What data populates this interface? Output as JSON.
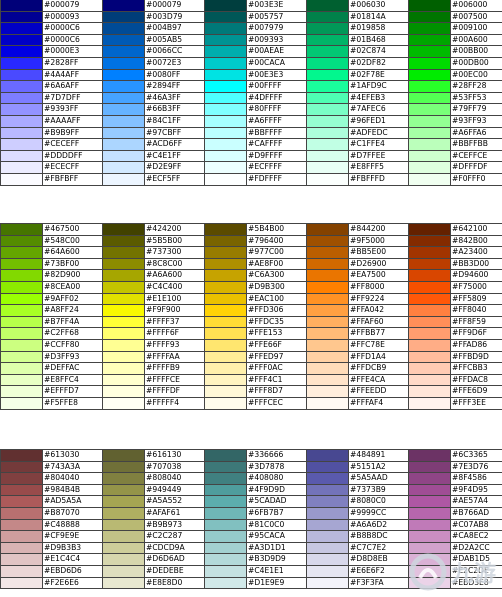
{
  "palette_blocks": [
    {
      "columns": [
        [
          "#000079",
          "#000093",
          "#0000C6",
          "#0000C6",
          "#0000E3",
          "#2828FF",
          "#4A4AFF",
          "#6A6AFF",
          "#7D7DFF",
          "#9393FF",
          "#AAAAFF",
          "#B9B9FF",
          "#CECEFF",
          "#DDDDFF",
          "#ECECFF",
          "#FBFBFF"
        ],
        [
          "#000079",
          "#003D79",
          "#004B97",
          "#005AB5",
          "#0066CC",
          "#0072E3",
          "#0080FF",
          "#2894FF",
          "#46A3FF",
          "#66B3FF",
          "#84C1FF",
          "#97CBFF",
          "#ACD6FF",
          "#C4E1FF",
          "#D2E9FF",
          "#ECF5FF"
        ],
        [
          "#003E3E",
          "#005757",
          "#007979",
          "#009393",
          "#00AEAE",
          "#00CACA",
          "#00E3E3",
          "#00FFFF",
          "#4DFFFF",
          "#80FFFF",
          "#A6FFFF",
          "#BBFFFF",
          "#CAFFFF",
          "#D9FFFF",
          "#ECFFFF",
          "#FDFFFF"
        ],
        [
          "#006030",
          "#01814A",
          "#019858",
          "#01B468",
          "#02C874",
          "#02DF82",
          "#02F78E",
          "#1AFD9C",
          "#4EFEB3",
          "#7AFEC6",
          "#96FED1",
          "#ADFEDC",
          "#C1FFE4",
          "#D7FFEE",
          "#E8FFF5",
          "#FBFFFD"
        ],
        [
          "#006000",
          "#007500",
          "#009100",
          "#00A600",
          "#00BB00",
          "#00DB00",
          "#00EC00",
          "#28FF28",
          "#53FF53",
          "#79FF79",
          "#93FF93",
          "#A6FFA6",
          "#BBFFBB",
          "#CEFFCE",
          "#DFFFDF",
          "#F0FFF0"
        ]
      ]
    },
    {
      "columns": [
        [
          "#467500",
          "#548C00",
          "#64A600",
          "#73BF00",
          "#82D900",
          "#8CEA00",
          "#9AFF02",
          "#A8FF24",
          "#B7FF4A",
          "#C2FF68",
          "#CCFF80",
          "#D3FF93",
          "#DEFFAC",
          "#E8FFC4",
          "#EFFFD7",
          "#F5FFE8"
        ],
        [
          "#424200",
          "#5B5B00",
          "#737300",
          "#8C8C00",
          "#A6A600",
          "#C4C400",
          "#E1E100",
          "#F9F900",
          "#FFFF37",
          "#FFFF6F",
          "#FFFF93",
          "#FFFFAA",
          "#FFFFB9",
          "#FFFFCE",
          "#FFFFDF",
          "#FFFFF4"
        ],
        [
          "#5B4B00",
          "#796400",
          "#977C00",
          "#AE8F00",
          "#C6A300",
          "#D9B300",
          "#EAC100",
          "#FFD306",
          "#FFDC35",
          "#FFE153",
          "#FFE66F",
          "#FFED97",
          "#FFF0AC",
          "#FFF4C1",
          "#FFF8D7",
          "#FFFCEC"
        ],
        [
          "#844200",
          "#9F5000",
          "#BB5E00",
          "#D26900",
          "#EA7500",
          "#FF8000",
          "#FF9224",
          "#FFA042",
          "#FFAF60",
          "#FFBB77",
          "#FFC78E",
          "#FFD1A4",
          "#FFDCB9",
          "#FFE4CA",
          "#FFEEDD",
          "#FFFAF4"
        ],
        [
          "#642100",
          "#842B00",
          "#A23400",
          "#BB3D00",
          "#D94600",
          "#F75000",
          "#FF5809",
          "#FF8040",
          "#FF8F59",
          "#FF9D6F",
          "#FFAD86",
          "#FFBD9D",
          "#FFCBB3",
          "#FFDAC8",
          "#FFE6D9",
          "#FFF3EE"
        ]
      ]
    },
    {
      "columns": [
        [
          "#613030",
          "#743A3A",
          "#804040",
          "#984B4B",
          "#AD5A5A",
          "#B87070",
          "#C48888",
          "#CF9E9E",
          "#D9B3B3",
          "#E1C4C4",
          "#EBD6D6",
          "#F2E6E6"
        ],
        [
          "#616130",
          "#707038",
          "#808040",
          "#949449",
          "#A5A552",
          "#AFAF61",
          "#B9B973",
          "#C2C287",
          "#CDCD9A",
          "#D6D6AD",
          "#DEDEBE",
          "#E8E8D0"
        ],
        [
          "#336666",
          "#3D7878",
          "#408080",
          "#4F9D9D",
          "#5CADAD",
          "#6FB7B7",
          "#81C0C0",
          "#95CACA",
          "#A3D1D1",
          "#B3D9D9",
          "#C4E1E1",
          "#D1E9E9"
        ],
        [
          "#484891",
          "#5151A2",
          "#5A5AAD",
          "#7373B9",
          "#8080C0",
          "#9999CC",
          "#A6A6D2",
          "#B8B8DC",
          "#C7C7E2",
          "#D8D8EB",
          "#E6E6F2",
          "#F3F3FA"
        ],
        [
          "#6C3365",
          "#7E3D76",
          "#8F4586",
          "#9F4D95",
          "#AE57A4",
          "#B766AD",
          "#C07AB8",
          "#CA8EC2",
          "#D2A2CC",
          "#DAB1D5",
          "#E2C2DE",
          "#EBD3E8"
        ]
      ]
    }
  ],
  "watermark": {
    "text": "九游",
    "icon": "jiuyou-logo-icon"
  }
}
